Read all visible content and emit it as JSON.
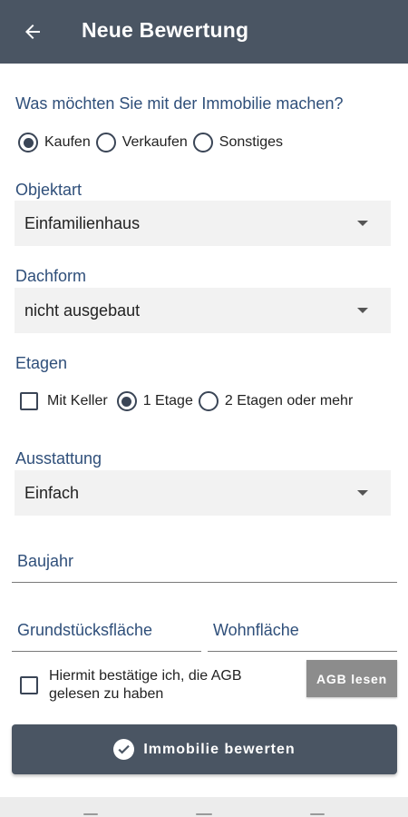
{
  "appbar": {
    "title": "Neue Bewertung",
    "back_icon": "arrow-left-icon"
  },
  "intent": {
    "question": "Was möchten Sie mit der Immobilie machen?",
    "options": [
      {
        "label": "Kaufen",
        "selected": true
      },
      {
        "label": "Verkaufen",
        "selected": false
      },
      {
        "label": "Sonstiges",
        "selected": false
      }
    ]
  },
  "objektart": {
    "label": "Objektart",
    "value": "Einfamilienhaus"
  },
  "dachform": {
    "label": "Dachform",
    "value": "nicht ausgebaut"
  },
  "etagen": {
    "label": "Etagen",
    "keller_label": "Mit Keller",
    "keller_checked": false,
    "options": [
      {
        "label": "1 Etage",
        "selected": true
      },
      {
        "label": "2 Etagen oder mehr",
        "selected": false
      }
    ]
  },
  "ausstattung": {
    "label": "Ausstattung",
    "value": "Einfach"
  },
  "baujahr": {
    "placeholder": "Baujahr"
  },
  "grundstueck": {
    "placeholder": "Grundstücksfläche"
  },
  "wohnflaeche": {
    "placeholder": "Wohnfläche"
  },
  "agb": {
    "text": "Hiermit bestätige ich, die AGB gelesen zu haben",
    "checked": false,
    "button_label": "AGB lesen"
  },
  "submit": {
    "label": "Immobilie bewerten",
    "icon": "check-circle-icon"
  },
  "colors": {
    "primary": "#4a5563",
    "label_blue": "#2f4f7a",
    "field_bg": "#f2f2f2",
    "secondary_button": "#8c8c8c"
  }
}
